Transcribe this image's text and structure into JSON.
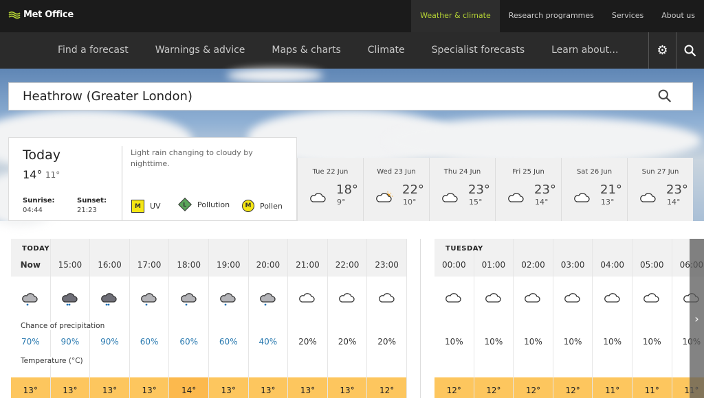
{
  "header": {
    "brand": "Met Office",
    "top_links": [
      "Weather & climate",
      "Research programmes",
      "Services",
      "About us"
    ],
    "active_top": 0,
    "accent": "#b5d334"
  },
  "nav": {
    "items": [
      "Find a forecast",
      "Warnings & advice",
      "Maps & charts",
      "Climate",
      "Specialist forecasts",
      "Learn about..."
    ],
    "settings_icon": "gear-icon",
    "search_icon": "search-icon"
  },
  "search": {
    "value": "Heathrow (Greater London)"
  },
  "today": {
    "title": "Today",
    "high": "14°",
    "low": "11°",
    "sunrise_label": "Sunrise:",
    "sunrise": "04:44",
    "sunset_label": "Sunset:",
    "sunset": "21:23",
    "summary": "Light rain changing to cloudy by nighttime.",
    "uv": {
      "level": "M",
      "label": "UV"
    },
    "pollution": {
      "level": "L",
      "label": "Pollution"
    },
    "pollen": {
      "level": "M",
      "label": "Pollen"
    }
  },
  "days": [
    {
      "label": "Tue 22 Jun",
      "high": "18°",
      "low": "9°",
      "icon": "cloud"
    },
    {
      "label": "Wed 23 Jun",
      "high": "22°",
      "low": "10°",
      "icon": "sun-cloud"
    },
    {
      "label": "Thu 24 Jun",
      "high": "23°",
      "low": "15°",
      "icon": "cloud"
    },
    {
      "label": "Fri 25 Jun",
      "high": "23°",
      "low": "14°",
      "icon": "cloud"
    },
    {
      "label": "Sat 26 Jun",
      "high": "21°",
      "low": "13°",
      "icon": "cloud"
    },
    {
      "label": "Sun 27 Jun",
      "high": "23°",
      "low": "14°",
      "icon": "cloud"
    }
  ],
  "hourly": {
    "precip_label": "Chance of precipitation",
    "temp_label": "Temperature (°C)",
    "today": {
      "label": "TODAY",
      "hours": [
        {
          "time": "Now",
          "icon": "light-rain",
          "precip": "70%",
          "temp": "13°"
        },
        {
          "time": "15:00",
          "icon": "heavy-rain",
          "precip": "90%",
          "temp": "13°"
        },
        {
          "time": "16:00",
          "icon": "heavy-rain",
          "precip": "90%",
          "temp": "13°"
        },
        {
          "time": "17:00",
          "icon": "light-rain",
          "precip": "60%",
          "temp": "13°"
        },
        {
          "time": "18:00",
          "icon": "light-rain",
          "precip": "60%",
          "temp": "14°"
        },
        {
          "time": "19:00",
          "icon": "light-rain",
          "precip": "60%",
          "temp": "13°"
        },
        {
          "time": "20:00",
          "icon": "light-rain",
          "precip": "40%",
          "temp": "13°"
        },
        {
          "time": "21:00",
          "icon": "cloud",
          "precip": "20%",
          "temp": "13°"
        },
        {
          "time": "22:00",
          "icon": "cloud",
          "precip": "20%",
          "temp": "13°"
        },
        {
          "time": "23:00",
          "icon": "cloud",
          "precip": "20%",
          "temp": "12°"
        }
      ]
    },
    "tuesday": {
      "label": "TUESDAY",
      "hours": [
        {
          "time": "00:00",
          "icon": "cloud",
          "precip": "10%",
          "temp": "12°"
        },
        {
          "time": "01:00",
          "icon": "cloud",
          "precip": "10%",
          "temp": "12°"
        },
        {
          "time": "02:00",
          "icon": "cloud",
          "precip": "10%",
          "temp": "12°"
        },
        {
          "time": "03:00",
          "icon": "cloud",
          "precip": "10%",
          "temp": "12°"
        },
        {
          "time": "04:00",
          "icon": "cloud",
          "precip": "10%",
          "temp": "11°"
        },
        {
          "time": "05:00",
          "icon": "cloud",
          "precip": "10%",
          "temp": "11°"
        },
        {
          "time": "06:00",
          "icon": "cloud",
          "precip": "10%",
          "temp": "11°"
        }
      ]
    }
  },
  "colors": {
    "precip_high": "#2a7ab0",
    "temp_bar": "#fdc65e",
    "temp_bar_warm": "#fcb94d"
  }
}
